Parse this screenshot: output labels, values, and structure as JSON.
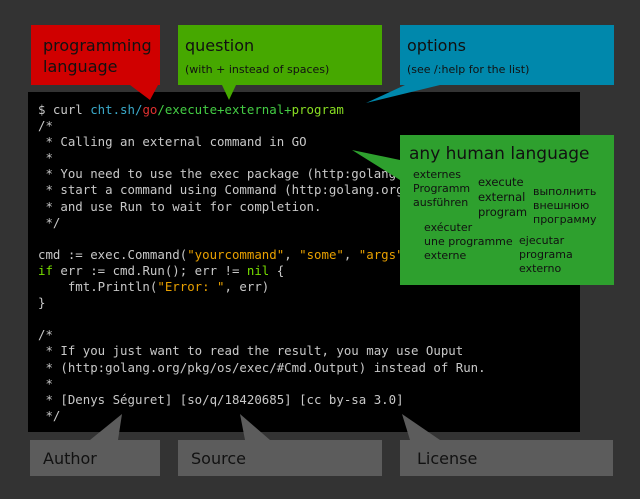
{
  "callouts": {
    "language": {
      "title_line1": "programming",
      "title_line2": "language",
      "color": "#d00000"
    },
    "question": {
      "title": "question",
      "subtitle": "(with + instead of spaces)",
      "color": "#46a800"
    },
    "options": {
      "title": "options",
      "subtitle": "(see /:help for the list)",
      "color": "#0088ac"
    }
  },
  "terminal": {
    "prompt": "$ curl ",
    "host": "cht.sh/",
    "lang": "go",
    "query": "/execute+external+",
    "query_end": "program",
    "comment1": [
      "/*",
      " * Calling an external command in GO",
      " *",
      " * You need to use the exec package (http:golang.org/pkg/os/exec/)",
      " * start a command using Command (http:golang.org/pkg/os/exec/#Command)",
      " * and use Run to wait for completion.",
      " */"
    ],
    "code_cmd": "cmd := exec.Command(",
    "str_cmd": "\"yourcommand\"",
    "str_some": "\"some\"",
    "str_args": "\"args\"",
    "sep": ", ",
    "code_end": ")",
    "kw_if": "if",
    "code_if": " err := cmd.Run(); err != ",
    "kw_nil": "nil",
    "code_brace": " {",
    "code_fmt": "    fmt.Println(",
    "str_err": "\"Error: \"",
    "code_err": ", err)",
    "code_close": "}",
    "comment2": [
      "/*",
      " * If you just want to read the result, you may use Ouput",
      " * (http:golang.org/pkg/os/exec/#Cmd.Output) instead of Run.",
      " *",
      " * [Denys Séguret] [so/q/18420685] [cc by-sa 3.0]",
      " */"
    ]
  },
  "human": {
    "title": "any human language",
    "phrases": {
      "de": [
        "externes",
        "Programm",
        "ausführen"
      ],
      "en": [
        "execute",
        "external",
        "program"
      ],
      "ru": [
        "выполнить",
        "внешнюю",
        "программу"
      ],
      "fr": [
        "exécuter",
        "une programme",
        "externe"
      ],
      "es": [
        "ejecutar",
        "programa",
        "externo"
      ]
    },
    "color": "#2ea02e"
  },
  "footer": {
    "author": "Author",
    "source": "Source",
    "license": "License"
  }
}
